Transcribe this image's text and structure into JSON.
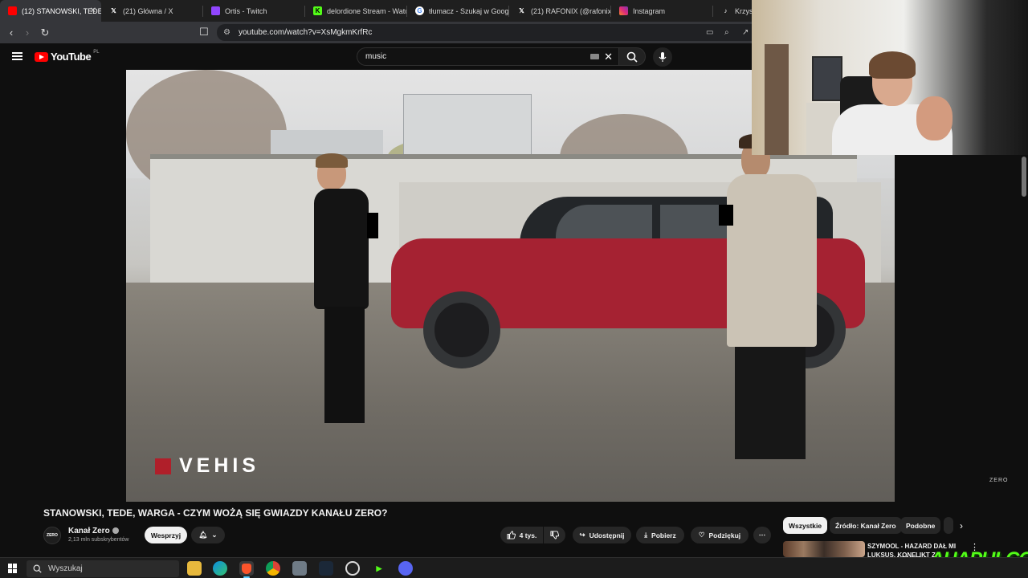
{
  "browser": {
    "tabs": [
      {
        "label": "(12) STANOWSKI, TEDE",
        "active": true,
        "favicon": "youtube-icon",
        "color": "#ff0000"
      },
      {
        "label": "(21) Główna / X",
        "active": false,
        "favicon": "x-icon",
        "color": "#000000"
      },
      {
        "label": "Ortis - Twitch",
        "active": false,
        "favicon": "twitch-icon",
        "color": "#9146ff"
      },
      {
        "label": "delordione Stream - Watch",
        "active": false,
        "favicon": "kick-icon",
        "color": "#53fc18"
      },
      {
        "label": "tłumacz - Szukaj w Google",
        "active": false,
        "favicon": "google-icon",
        "color": "#4285f4"
      },
      {
        "label": "(21) RAFONIX (@rafonixxx",
        "active": false,
        "favicon": "x-icon",
        "color": "#000000"
      },
      {
        "label": "Instagram",
        "active": false,
        "favicon": "instagram-icon",
        "color": "#e1306c"
      },
      {
        "label": "Krzyszt",
        "active": false,
        "favicon": "tiktok-icon",
        "color": "#111111"
      }
    ],
    "url": "youtube.com/watch?v=XsMgkmKrfRc"
  },
  "youtube": {
    "logo_text": "YouTube",
    "country_code": "PL",
    "search_value": "music"
  },
  "video": {
    "overlay_brand": "VEHIS",
    "watermark": "ZERO",
    "title": "STANOWSKI, TEDE, WARGA - CZYM WOŻĄ SIĘ GWIAZDY KANAŁU ZERO?",
    "channel": {
      "avatar_text": "ZERO",
      "name": "Kanał Zero",
      "subscribers": "2,13 mln subskrybentów"
    },
    "actions": {
      "support": "Wesprzyj",
      "likes": "4 tys.",
      "share": "Udostępnij",
      "download": "Pobierz",
      "thanks": "Podziękuj"
    }
  },
  "related": {
    "chips": [
      "Wszystkie",
      "Źródło: Kanał Zero",
      "Podobne"
    ],
    "first_title_line1": "SZYMOOL - HAZARD DAŁ MI",
    "first_title_line2": "LUKSUS. KONFLIKT Z"
  },
  "stream_overlay": {
    "kick_label": "KICK",
    "streamer": "AHAPULCO"
  },
  "taskbar": {
    "search_placeholder": "Wyszukaj",
    "apps": [
      "file-explorer-icon",
      "edge-icon",
      "brave-icon",
      "chrome-icon",
      "app-icon",
      "steam-icon",
      "obs-icon",
      "kick-icon",
      "discord-icon"
    ]
  }
}
